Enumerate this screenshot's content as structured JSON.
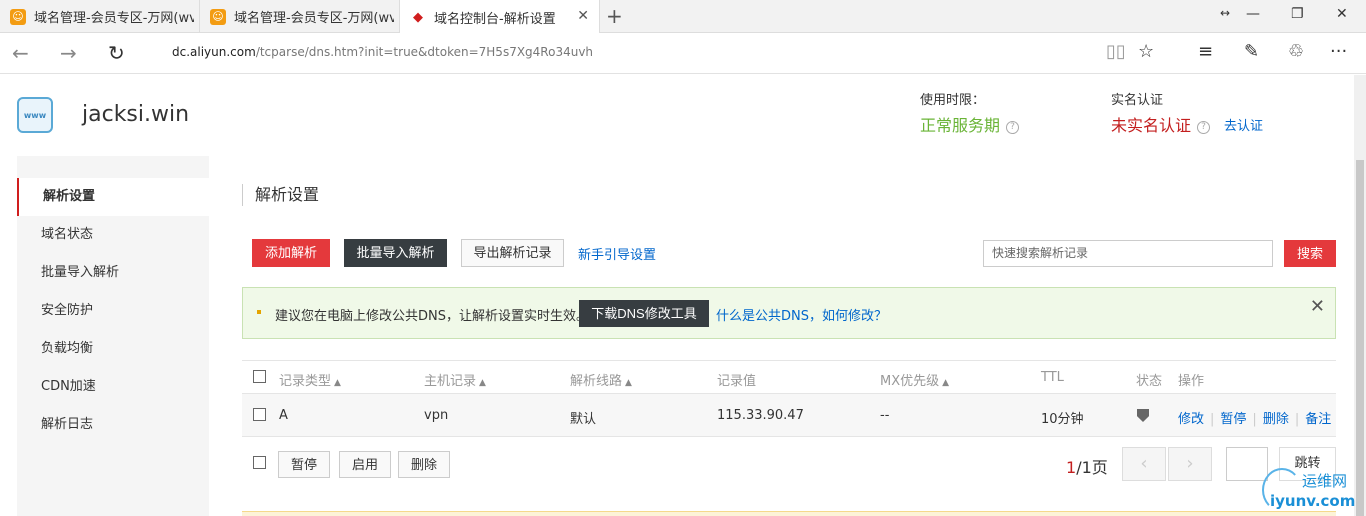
{
  "browser": {
    "tabs": [
      {
        "title": "域名管理-会员专区-万网(wv",
        "active": false
      },
      {
        "title": "域名管理-会员专区-万网(wv",
        "active": false
      },
      {
        "title": "域名控制台-解析设置",
        "active": true
      }
    ],
    "url_host": "dc.aliyun.com",
    "url_path": "/tcparse/dns.htm?init=true&dtoken=7H5s7Xg4Ro34uvh"
  },
  "header": {
    "domain": "jacksi.win",
    "logo_text": "www",
    "service_label": "使用时限：",
    "service_status": "正常服务期",
    "realname_label": "实名认证",
    "realname_status": "未实名认证",
    "realname_link": "去认证",
    "colors": {
      "service_ok": "#6ab437",
      "alert": "#c31f1f"
    }
  },
  "sidebar": {
    "items": [
      {
        "label": "解析设置",
        "active": true
      },
      {
        "label": "域名状态"
      },
      {
        "label": "批量导入解析"
      },
      {
        "label": "安全防护"
      },
      {
        "label": "负载均衡"
      },
      {
        "label": "CDN加速"
      },
      {
        "label": "解析日志"
      }
    ]
  },
  "main": {
    "title": "解析设置",
    "toolbar": {
      "add": "添加解析",
      "batch_import": "批量导入解析",
      "export": "导出解析记录",
      "guide": "新手引导设置",
      "search_placeholder": "快速搜索解析记录",
      "search_button": "搜索"
    },
    "notice": {
      "text": "建议您在电脑上修改公共DNS，让解析设置实时生效。",
      "download_button": "下载DNS修改工具",
      "link": "什么是公共DNS，如何修改？"
    },
    "table": {
      "columns": [
        "记录类型",
        "主机记录",
        "解析线路",
        "记录值",
        "MX优先级",
        "TTL",
        "状态",
        "操作"
      ],
      "rows": [
        {
          "type": "A",
          "host": "vpn",
          "line": "默认",
          "value": "115.33.90.47",
          "mx": "--",
          "ttl": "10分钟",
          "status_icon": "shield-icon",
          "ops": [
            "修改",
            "暂停",
            "删除",
            "备注"
          ]
        }
      ],
      "footer_buttons": [
        "暂停",
        "启用",
        "删除"
      ],
      "pager": {
        "current": "1",
        "total_text": "/1页",
        "prev": "‹",
        "next": "›",
        "jump": "跳转"
      }
    }
  },
  "watermark": {
    "line1": "运维网",
    "line2": "iyunv.com"
  }
}
